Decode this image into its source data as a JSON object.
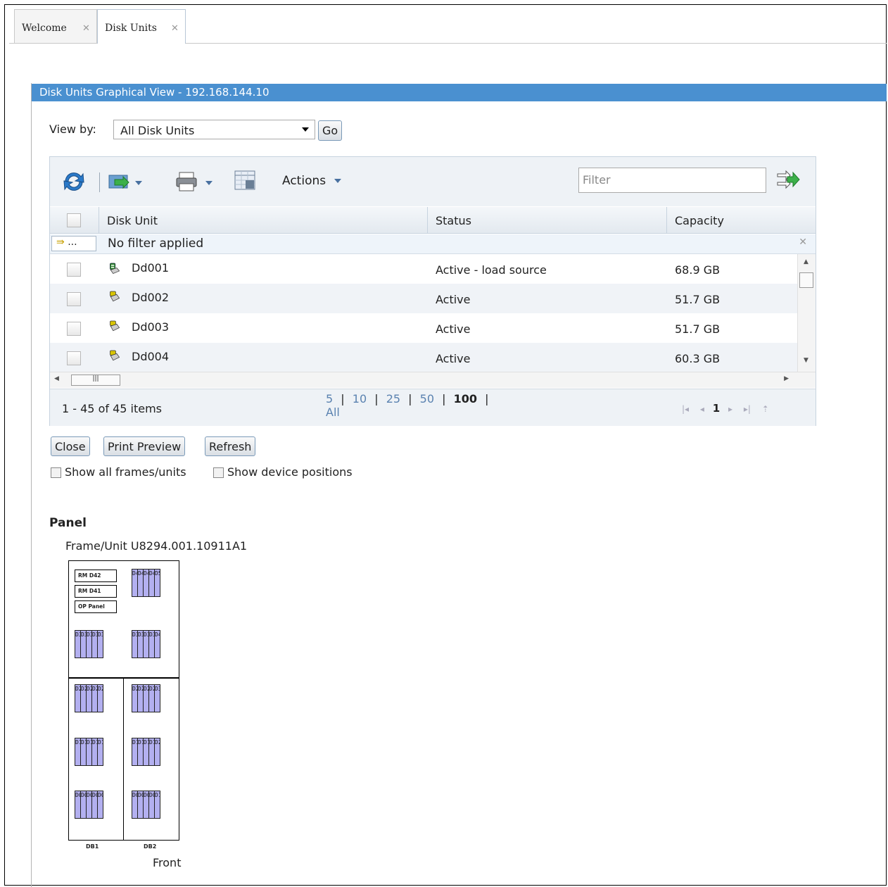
{
  "tabs": [
    {
      "label": "Welcome"
    },
    {
      "label": "Disk Units"
    }
  ],
  "panel_header": "Disk Units Graphical View - 192.168.144.10",
  "view_by": {
    "label": "View by:",
    "selected": "All Disk Units",
    "go_label": "Go"
  },
  "toolbar": {
    "actions_label": "Actions",
    "filter_placeholder": "Filter"
  },
  "table": {
    "columns": [
      "Disk Unit",
      "Status",
      "Capacity"
    ],
    "filter_status": "No filter applied",
    "filter_icon_text": "...",
    "rows": [
      {
        "unit": "Dd001",
        "status": "Active - load source",
        "capacity": "68.9 GB",
        "icon": "disk-load-source-icon"
      },
      {
        "unit": "Dd002",
        "status": "Active",
        "capacity": "51.7 GB",
        "icon": "disk-unit-icon"
      },
      {
        "unit": "Dd003",
        "status": "Active",
        "capacity": "51.7 GB",
        "icon": "disk-unit-icon"
      },
      {
        "unit": "Dd004",
        "status": "Active",
        "capacity": "60.3 GB",
        "icon": "disk-unit-icon"
      }
    ],
    "item_count": "1 - 45 of 45 items",
    "page_sizes": [
      "5",
      "10",
      "25",
      "50",
      "100",
      "All"
    ],
    "page_size_sep": "|",
    "current_page": "1"
  },
  "buttons": {
    "close": "Close",
    "print_preview": "Print Preview",
    "refresh": "Refresh"
  },
  "checkboxes": {
    "show_all_frames": "Show all frames/units",
    "show_device_positions": "Show device positions"
  },
  "panel": {
    "title": "Panel",
    "frame_unit": "Frame/Unit U8294.001.10911A1",
    "rm1": "RM D42",
    "rm2": "RM D41",
    "op_panel": "OP Panel",
    "db1": "DB1",
    "db2": "DB2",
    "front": "Front",
    "bays": [
      [
        "D46",
        "D47",
        "D48",
        "D49",
        "D50"
      ],
      [
        "D31",
        "D32",
        "D33",
        "D34",
        "D35"
      ],
      [
        "D36",
        "D37",
        "D38",
        "D39",
        "D40"
      ],
      [
        "D21",
        "D22",
        "D23",
        "D24",
        "D25"
      ],
      [
        "D26",
        "D27",
        "D28",
        "D29",
        "D30"
      ],
      [
        "D11",
        "D12",
        "D13",
        "D14",
        "D15"
      ],
      [
        "D16",
        "D17",
        "D18",
        "D19",
        "D20"
      ],
      [
        "D01",
        "D02",
        "D03",
        "D04",
        "D05"
      ],
      [
        "D06",
        "D07",
        "D08",
        "D09",
        "D10"
      ]
    ]
  },
  "colors": {
    "header_blue": "#4a90d0",
    "slot_fill": "#b3b0f0",
    "link_blue": "#5a82b0"
  }
}
